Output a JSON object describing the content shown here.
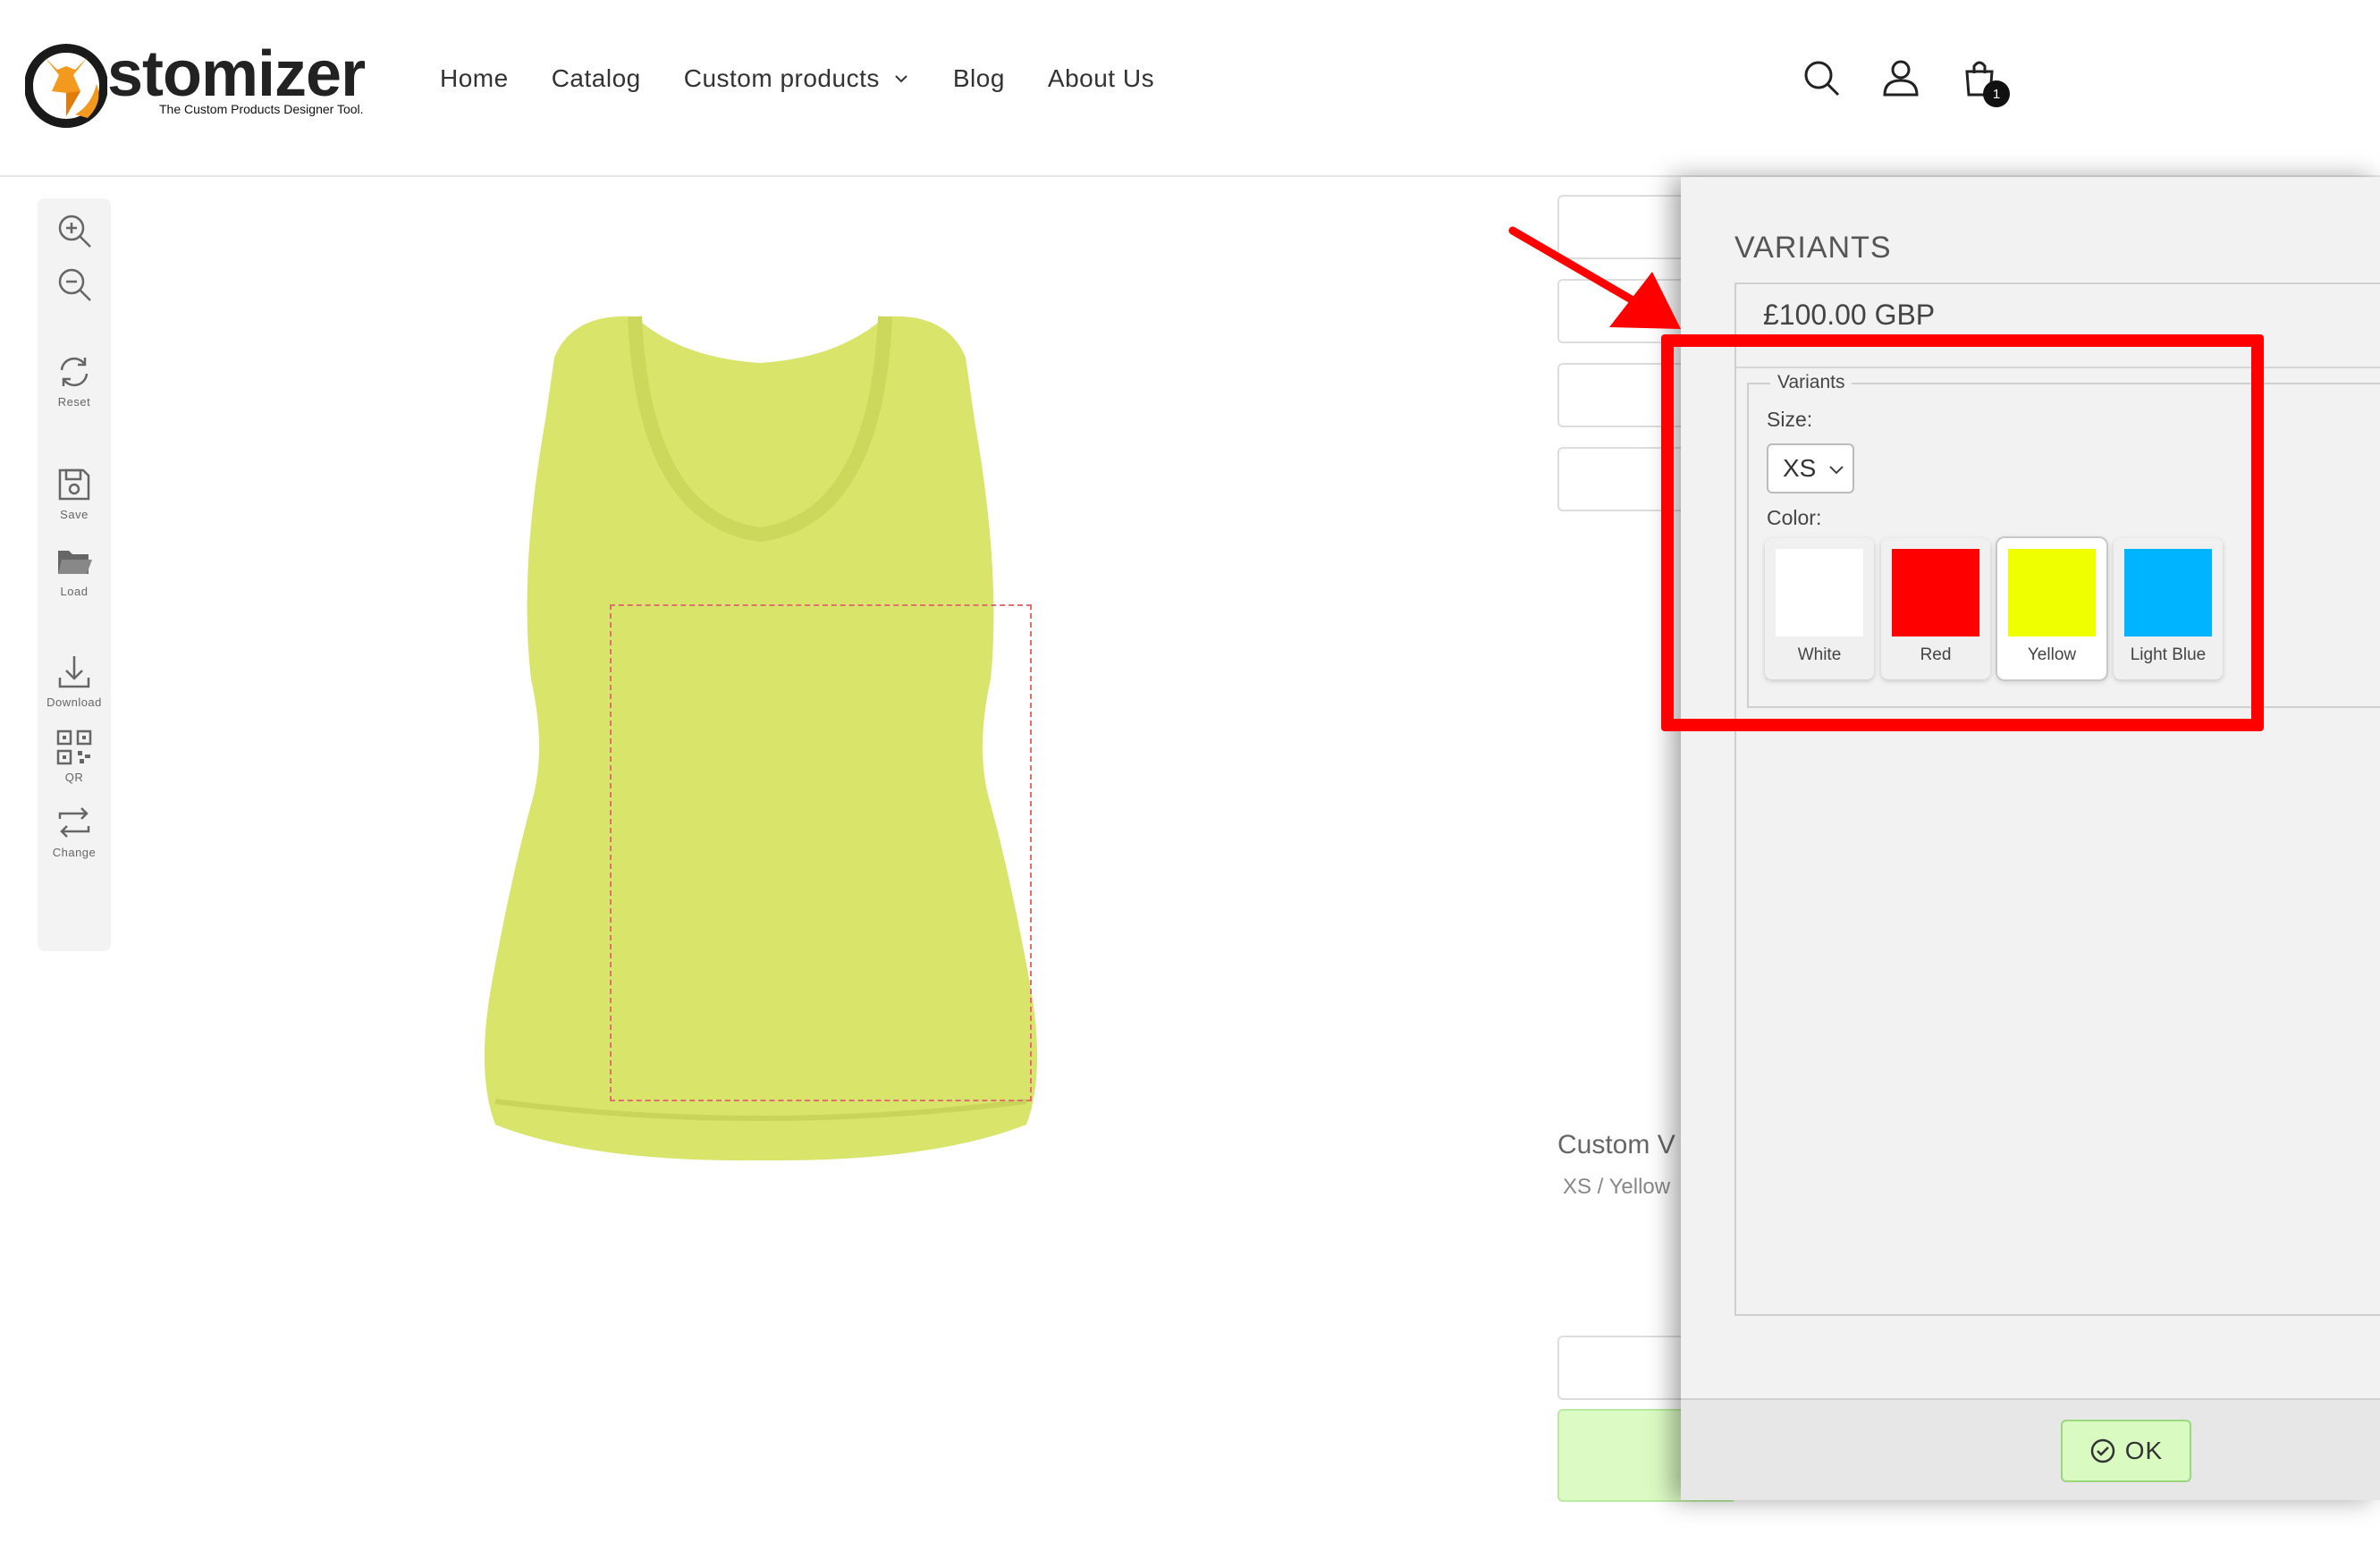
{
  "header": {
    "logo": {
      "wordmark": "stomizer",
      "tagline": "The Custom Products Designer Tool."
    },
    "nav": [
      {
        "label": "Home"
      },
      {
        "label": "Catalog"
      },
      {
        "label": "Custom products",
        "has_dropdown": true
      },
      {
        "label": "Blog"
      },
      {
        "label": "About Us"
      }
    ],
    "icons": [
      "search-icon",
      "account-icon",
      "cart-icon"
    ],
    "cart_count": "1"
  },
  "toolbar": {
    "tools": [
      {
        "icon": "zoom-in-icon",
        "label": ""
      },
      {
        "icon": "zoom-out-icon",
        "label": ""
      },
      {
        "icon": "reset-icon",
        "label": "Reset"
      },
      {
        "icon": "save-icon",
        "label": "Save"
      },
      {
        "icon": "load-icon",
        "label": "Load"
      },
      {
        "icon": "download-icon",
        "label": "Download"
      },
      {
        "icon": "qr-icon",
        "label": "QR"
      },
      {
        "icon": "change-icon",
        "label": "Change"
      }
    ]
  },
  "product": {
    "color": "#d8e46a"
  },
  "background": {
    "product_title": "Custom V",
    "variant_summary": "XS / Yellow"
  },
  "variants_panel": {
    "title": "VARIANTS",
    "price": "£100.00 GBP",
    "legend": "Variants",
    "size_label": "Size:",
    "size_value": "XS",
    "color_label": "Color:",
    "colors": [
      {
        "name": "White",
        "hex": "#ffffff"
      },
      {
        "name": "Red",
        "hex": "#ff0000"
      },
      {
        "name": "Yellow",
        "hex": "#f0ff00",
        "selected": true
      },
      {
        "name": "Light Blue",
        "hex": "#00b4ff"
      }
    ],
    "ok_label": "OK"
  },
  "annotation": {
    "color": "#ff0000"
  }
}
